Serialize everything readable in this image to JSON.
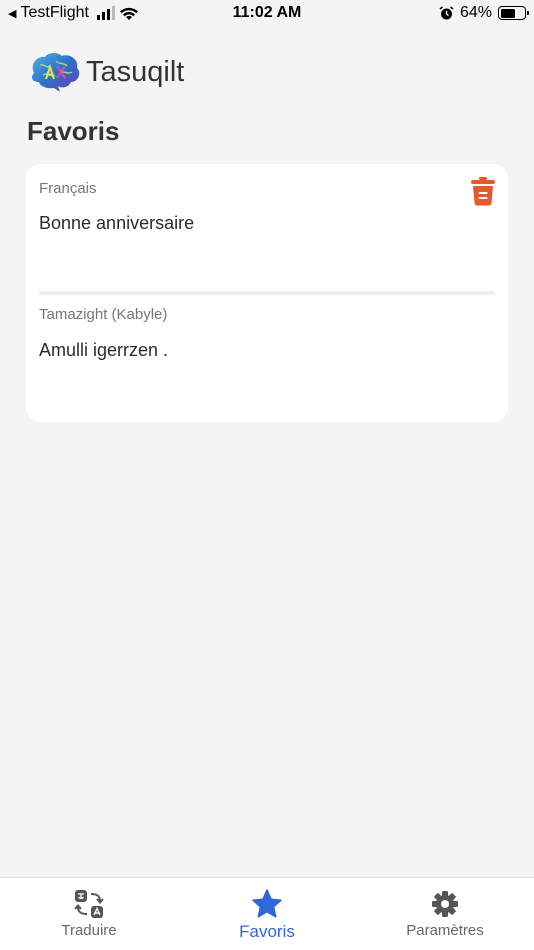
{
  "status_bar": {
    "carrier": "TestFlight",
    "time": "11:02 AM",
    "battery": "64%",
    "battery_level": 0.64
  },
  "app": {
    "name": "Tasuqilt"
  },
  "page": {
    "title": "Favoris"
  },
  "favorites": [
    {
      "source_lang": "Français",
      "source_text": "Bonne anniversaire",
      "target_lang": "Tamazight (Kabyle)",
      "target_text": "Amulli igerrzen ."
    }
  ],
  "tabs": [
    {
      "label": "Traduire",
      "icon": "translate-icon",
      "active": false
    },
    {
      "label": "Favoris",
      "icon": "star-icon",
      "active": true
    },
    {
      "label": "Paramètres",
      "icon": "gear-icon",
      "active": false
    }
  ],
  "colors": {
    "accent": "#2f66d8",
    "delete": "#e8582a",
    "background": "#f4f4f4"
  }
}
